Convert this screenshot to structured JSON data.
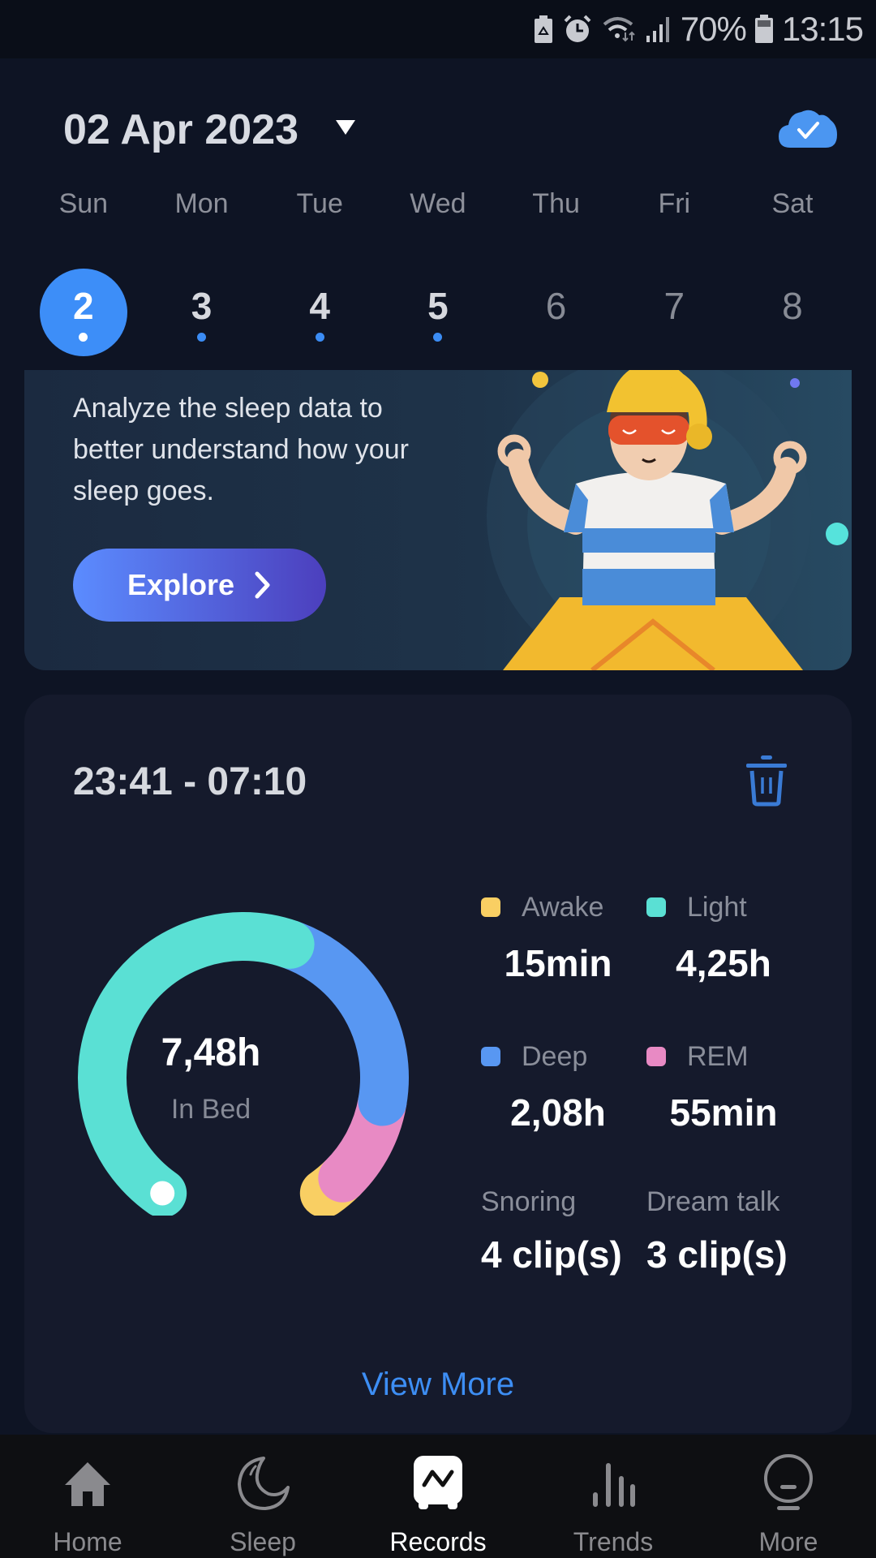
{
  "status_bar": {
    "icons": [
      "battery-saver-icon",
      "alarm-icon",
      "wifi-icon",
      "signal-icon",
      "battery-icon"
    ],
    "battery_percent": "70%",
    "time": "13:15"
  },
  "header": {
    "date": "02 Apr 2023",
    "dropdown_icon": "caret-down-icon",
    "sync_icon": "cloud-check-icon"
  },
  "week": {
    "days": [
      "Sun",
      "Mon",
      "Tue",
      "Wed",
      "Thu",
      "Fri",
      "Sat"
    ],
    "dates": [
      {
        "day": "2",
        "selected": true,
        "has_record": true
      },
      {
        "day": "3",
        "selected": false,
        "has_record": true
      },
      {
        "day": "4",
        "selected": false,
        "has_record": true
      },
      {
        "day": "5",
        "selected": false,
        "has_record": true
      },
      {
        "day": "6",
        "selected": false,
        "has_record": false
      },
      {
        "day": "7",
        "selected": false,
        "has_record": false
      },
      {
        "day": "8",
        "selected": false,
        "has_record": false
      }
    ]
  },
  "banner": {
    "text": "Analyze the sleep data to better understand how your sleep goes.",
    "button_label": "Explore",
    "button_icon": "chevron-right-icon",
    "illustration": "sleeping-character-illustration"
  },
  "record": {
    "time_range": "23:41 - 07:10",
    "delete_icon": "trash-icon",
    "total_value": "7,48h",
    "total_label": "In Bed",
    "stages": [
      {
        "key": "awake",
        "label": "Awake",
        "value": "15min",
        "color": "#f9cf63"
      },
      {
        "key": "light",
        "label": "Light",
        "value": "4,25h",
        "color": "#5ae0d4"
      },
      {
        "key": "deep",
        "label": "Deep",
        "value": "2,08h",
        "color": "#5897f2"
      },
      {
        "key": "rem",
        "label": "REM",
        "value": "55min",
        "color": "#e88ac4"
      }
    ],
    "extras": [
      {
        "label": "Snoring",
        "value": "4 clip(s)"
      },
      {
        "label": "Dream talk",
        "value": "3 clip(s)"
      }
    ],
    "view_more_label": "View More"
  },
  "gauge": {
    "segment_order": [
      "light",
      "deep",
      "rem",
      "awake"
    ],
    "segment_hours": {
      "light": 4.25,
      "deep": 2.08,
      "rem": 0.92,
      "awake": 0.25
    },
    "colors": {
      "light": "#5ae0d4",
      "deep": "#5897f2",
      "rem": "#e88ac4",
      "awake": "#f9cf63"
    }
  },
  "bottom_nav": [
    {
      "label": "Home",
      "icon": "home-icon",
      "active": false
    },
    {
      "label": "Sleep",
      "icon": "moon-icon",
      "active": false
    },
    {
      "label": "Records",
      "icon": "records-chart-icon",
      "active": true
    },
    {
      "label": "Trends",
      "icon": "bar-chart-icon",
      "active": false
    },
    {
      "label": "More",
      "icon": "lightbulb-icon",
      "active": false
    }
  ],
  "colors": {
    "accent": "#3d8ef8",
    "link": "#3d8ef4",
    "background": "#0e1424",
    "card": "#151a2c"
  }
}
